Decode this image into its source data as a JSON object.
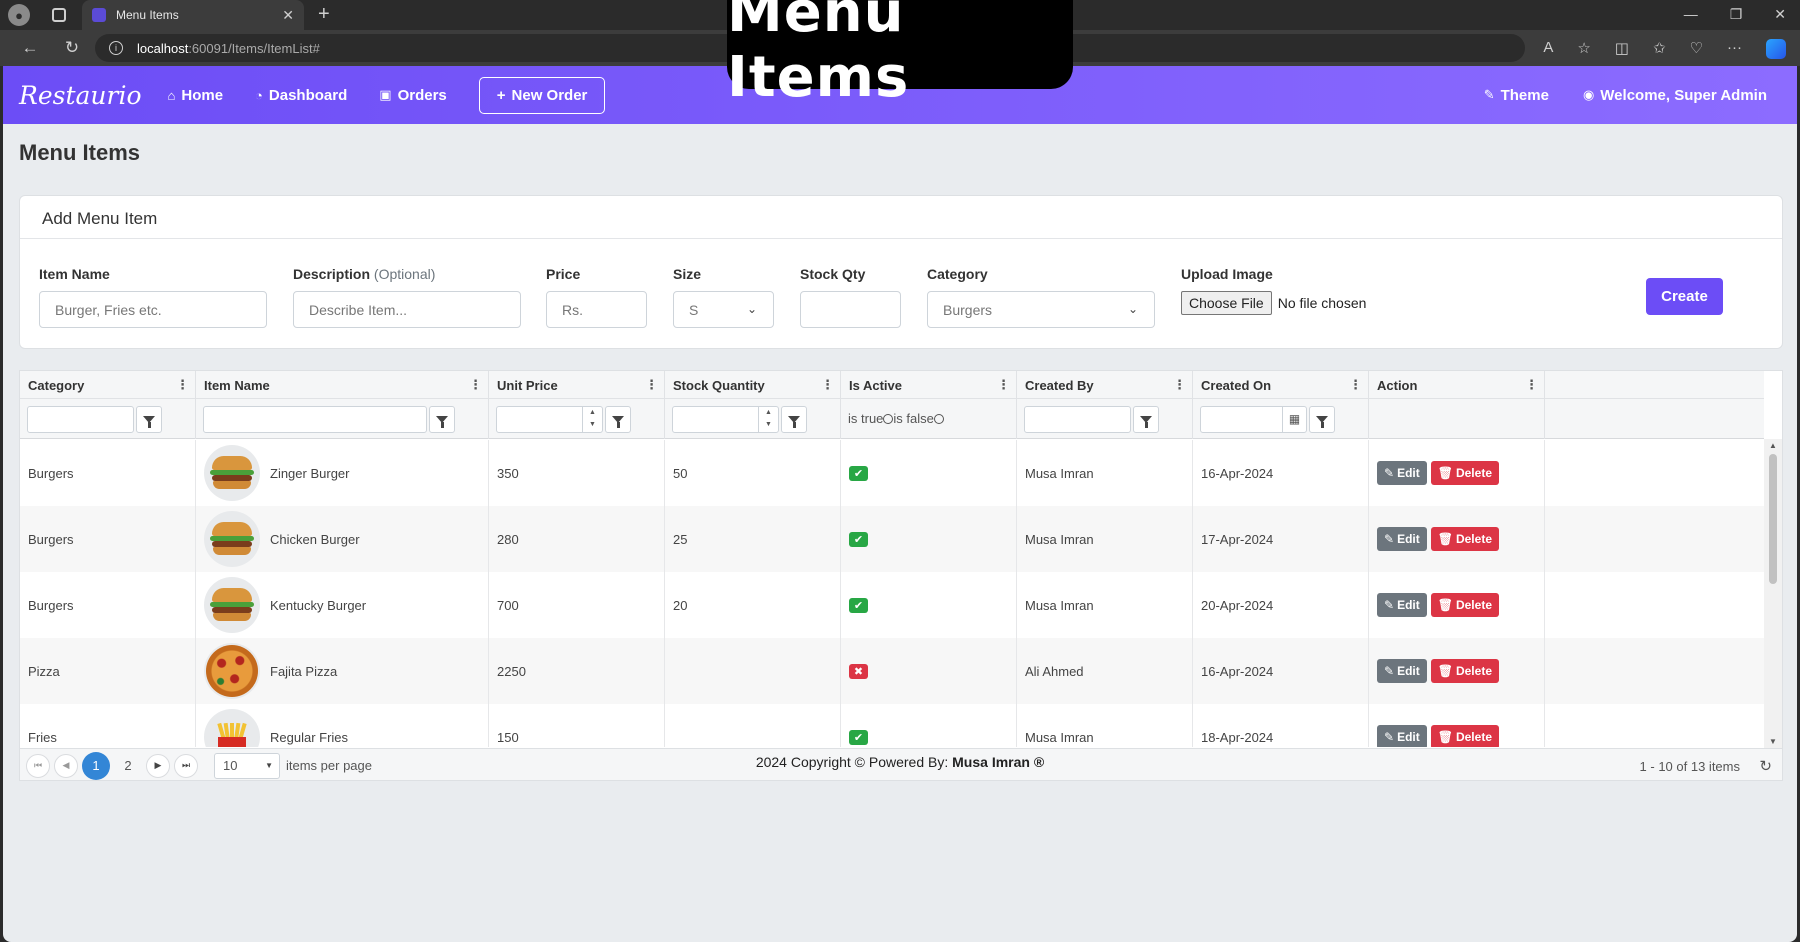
{
  "browser": {
    "tab_title": "Menu Items",
    "url_host": "localhost",
    "url_rest": ":60091/Items/ItemList#"
  },
  "overlay_title": "Menu Items",
  "navbar": {
    "brand": "Restaurio",
    "links": {
      "home": "Home",
      "dashboard": "Dashboard",
      "orders": "Orders"
    },
    "new_order": "New Order",
    "theme": "Theme",
    "welcome": "Welcome, Super Admin"
  },
  "page_title": "Menu Items",
  "add_form": {
    "card_title": "Add Menu Item",
    "item_name_label": "Item Name",
    "item_name_placeholder": "Burger, Fries etc.",
    "description_label": "Description",
    "description_optional": "(Optional)",
    "description_placeholder": "Describe Item...",
    "price_label": "Price",
    "price_placeholder": "Rs.",
    "size_label": "Size",
    "size_value": "S",
    "stock_label": "Stock Qty",
    "category_label": "Category",
    "category_value": "Burgers",
    "upload_label": "Upload Image",
    "choose_file": "Choose File",
    "no_file": "No file chosen",
    "create_label": "Create"
  },
  "grid": {
    "columns": [
      "Category",
      "Item Name",
      "Unit Price",
      "Stock Quantity",
      "Is Active",
      "Created By",
      "Created On",
      "Action"
    ],
    "active_filter_true": "is true",
    "active_filter_false": "is false",
    "edit_label": "Edit",
    "delete_label": "Delete",
    "rows": [
      {
        "category": "Burgers",
        "item": "Zinger Burger",
        "price": "350",
        "stock": "50",
        "active": true,
        "created_by": "Musa Imran",
        "created_on": "16-Apr-2024",
        "image": "burger"
      },
      {
        "category": "Burgers",
        "item": "Chicken Burger",
        "price": "280",
        "stock": "25",
        "active": true,
        "created_by": "Musa Imran",
        "created_on": "17-Apr-2024",
        "image": "burger"
      },
      {
        "category": "Burgers",
        "item": "Kentucky Burger",
        "price": "700",
        "stock": "20",
        "active": true,
        "created_by": "Musa Imran",
        "created_on": "20-Apr-2024",
        "image": "burger"
      },
      {
        "category": "Pizza",
        "item": "Fajita Pizza",
        "price": "2250",
        "stock": "",
        "active": false,
        "created_by": "Ali Ahmed",
        "created_on": "16-Apr-2024",
        "image": "pizza"
      },
      {
        "category": "Fries",
        "item": "Regular Fries",
        "price": "150",
        "stock": "",
        "active": true,
        "created_by": "Musa Imran",
        "created_on": "18-Apr-2024",
        "image": "fries"
      }
    ]
  },
  "pager": {
    "page1": "1",
    "page2": "2",
    "page_size": "10",
    "items_per_page": "items per page",
    "info": "1 - 10 of 13 items"
  },
  "footer": {
    "text": "2024 Copyright © Powered By:",
    "author": "Musa Imran ®"
  },
  "colors": {
    "brand": "#6c4df6",
    "success": "#28a745",
    "danger": "#dc3545",
    "pager_active": "#3386d6"
  }
}
